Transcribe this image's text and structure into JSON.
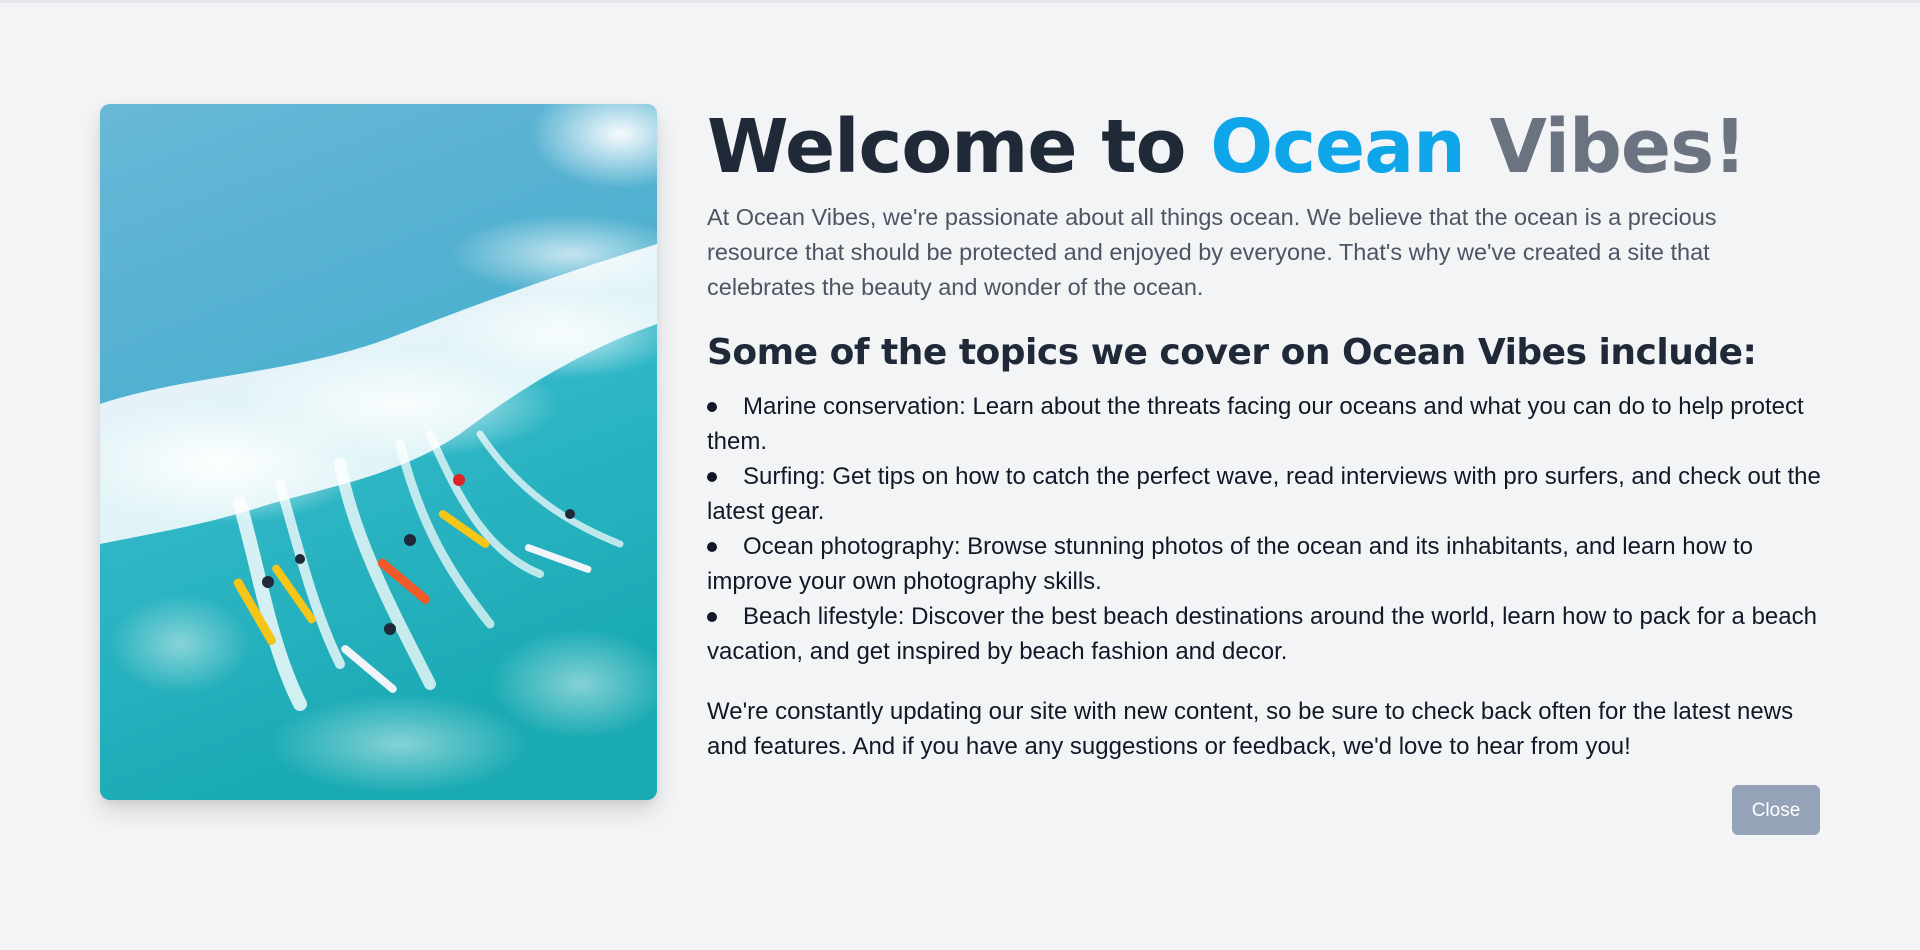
{
  "hero": {
    "image_alt": "surfers-riding-wave",
    "title_prefix": "Welcome to ",
    "title_highlight": "Ocean",
    "title_suffix": " Vibes!",
    "intro": "At Ocean Vibes, we're passionate about all things ocean. We believe that the ocean is a precious resource that should be protected and enjoyed by everyone. That's why we've created a site that celebrates the beauty and wonder of the ocean."
  },
  "topics": {
    "heading": "Some of the topics we cover on Ocean Vibes include:",
    "items": [
      {
        "text": "Marine conservation: Learn about the threats facing our oceans and what you can do to help protect them."
      },
      {
        "text": "Surfing: Get tips on how to catch the perfect wave, read interviews with pro surfers, and check out the latest gear."
      },
      {
        "text": "Ocean photography: Browse stunning photos of the ocean and its inhabitants, and learn how to improve your own photography skills."
      },
      {
        "text": "Beach lifestyle: Discover the best beach destinations around the world, learn how to pack for a beach vacation, and get inspired by beach fashion and decor."
      }
    ]
  },
  "outro": "We're constantly updating our site with new content, so be sure to check back often for the latest news and features. And if you have any suggestions or feedback, we'd love to hear from you!",
  "actions": {
    "close_label": "Close"
  },
  "colors": {
    "background": "#f3f4f6",
    "heading": "#1f2937",
    "accent_ocean": "#0ea5e9",
    "accent_vibes": "#6b7280",
    "button": "#94a3b8"
  }
}
